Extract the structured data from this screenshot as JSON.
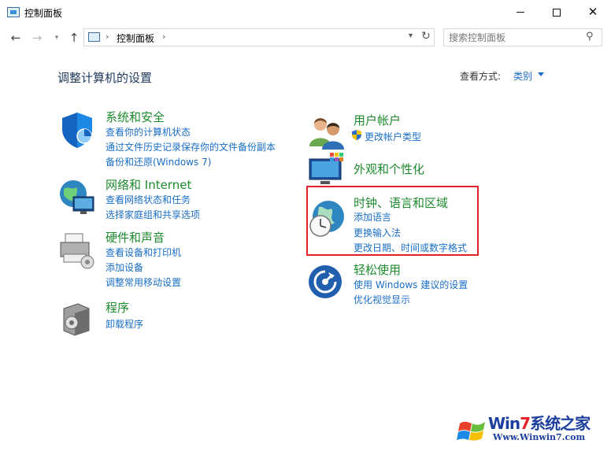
{
  "window": {
    "title": "控制面板",
    "minimize_label": "",
    "maximize_label": "",
    "close_label": "✕"
  },
  "nav": {
    "back_icon": "arrow-left-icon",
    "forward_icon": "arrow-right-icon",
    "up_icon": "arrow-up-icon",
    "breadcrumb": "控制面板",
    "search_placeholder": "搜索控制面板"
  },
  "header": {
    "title": "调整计算机的设置",
    "view_by_label": "查看方式:",
    "view_by_value": "类别"
  },
  "categories": {
    "system": {
      "title": "系统和安全",
      "links": [
        "查看你的计算机状态",
        "通过文件历史记录保存你的文件备份副本",
        "备份和还原(Windows 7)"
      ]
    },
    "network": {
      "title": "网络和 Internet",
      "links": [
        "查看网络状态和任务",
        "选择家庭组和共享选项"
      ]
    },
    "hardware": {
      "title": "硬件和声音",
      "links": [
        "查看设备和打印机",
        "添加设备",
        "调整常用移动设置"
      ]
    },
    "programs": {
      "title": "程序",
      "links": [
        "卸载程序"
      ]
    },
    "user": {
      "title": "用户帐户",
      "links": [
        "更改帐户类型"
      ]
    },
    "appearance": {
      "title": "外观和个性化",
      "links": []
    },
    "clock": {
      "title": "时钟、语言和区域",
      "links": [
        "添加语言",
        "更换输入法",
        "更改日期、时间或数字格式"
      ]
    },
    "ease": {
      "title": "轻松使用",
      "links": [
        "使用 Windows 建议的设置",
        "优化视觉显示"
      ]
    }
  },
  "watermark": {
    "brand_a": "Win",
    "brand_b": "7",
    "brand_c": "系统之家",
    "url": "Www.Winwin7.com"
  },
  "colors": {
    "category_title": "#1d8a2e",
    "link": "#1a6ec5",
    "highlight_border": "#e0232a"
  }
}
